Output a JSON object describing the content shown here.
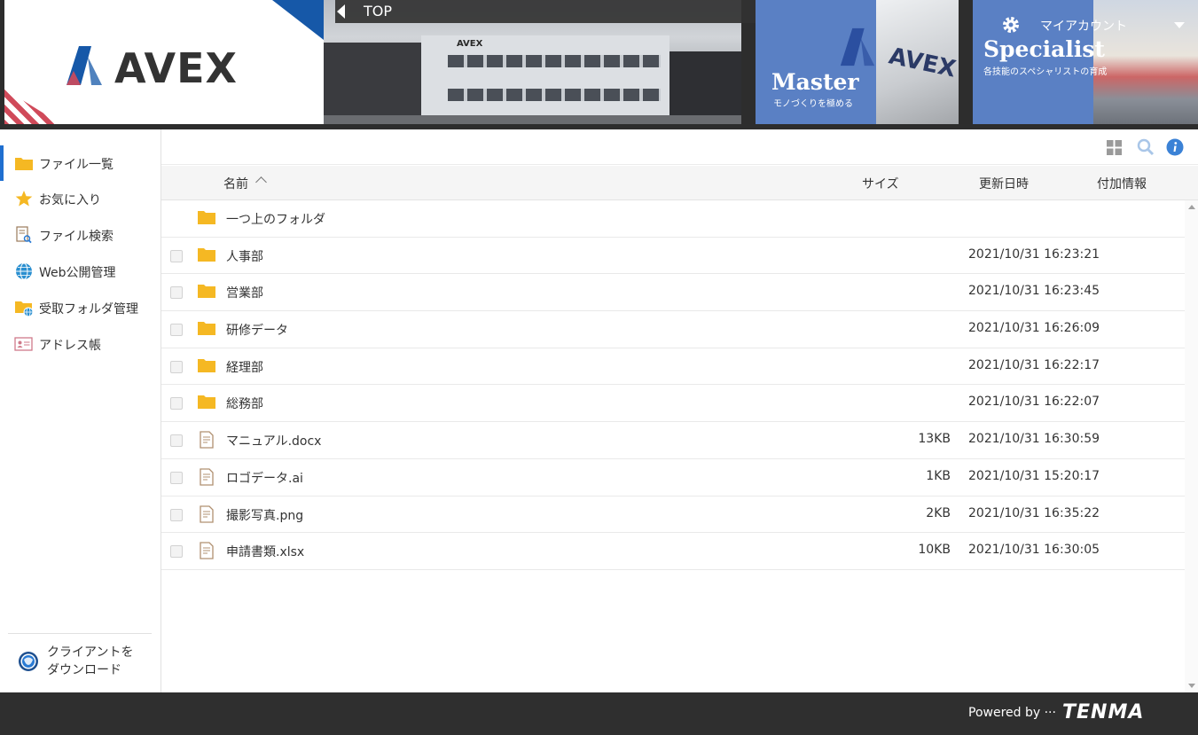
{
  "header": {
    "logo_text": "AVEX",
    "nav_title": "TOP",
    "building_sign": "AVEX",
    "tiles": {
      "master": {
        "title": "Master",
        "subtitle": "モノづくりを極める",
        "logo": "AVEX"
      },
      "specialist": {
        "title": "Specialist",
        "subtitle": "各技能のスペシャリストの育成"
      }
    },
    "account_label": "マイアカウント",
    "brand_colors": {
      "blue": "#1658a8",
      "tile_blue": "#5a80c4",
      "stripe_red": "#d04a5a"
    }
  },
  "sidebar": {
    "items": [
      {
        "label": "ファイル一覧",
        "icon": "folder-icon",
        "active": true
      },
      {
        "label": "お気に入り",
        "icon": "star-icon",
        "active": false
      },
      {
        "label": "ファイル検索",
        "icon": "file-search-icon",
        "active": false
      },
      {
        "label": "Web公開管理",
        "icon": "globe-icon",
        "active": false
      },
      {
        "label": "受取フォルダ管理",
        "icon": "folder-globe-icon",
        "active": false
      },
      {
        "label": "アドレス帳",
        "icon": "address-card-icon",
        "active": false
      }
    ],
    "client_download_line1": "クライアントを",
    "client_download_line2": "ダウンロード"
  },
  "table": {
    "columns": {
      "name": "名前",
      "size": "サイズ",
      "modified": "更新日時",
      "extra": "付加情報"
    },
    "parent_folder": "一つ上のフォルダ",
    "rows": [
      {
        "type": "folder",
        "name": "人事部",
        "size": "",
        "modified": "2021/10/31 16:23:21"
      },
      {
        "type": "folder",
        "name": "営業部",
        "size": "",
        "modified": "2021/10/31 16:23:45"
      },
      {
        "type": "folder",
        "name": "研修データ",
        "size": "",
        "modified": "2021/10/31 16:26:09"
      },
      {
        "type": "folder",
        "name": "経理部",
        "size": "",
        "modified": "2021/10/31 16:22:17"
      },
      {
        "type": "folder",
        "name": "総務部",
        "size": "",
        "modified": "2021/10/31 16:22:07"
      },
      {
        "type": "file",
        "name": "マニュアル.docx",
        "size": "13KB",
        "modified": "2021/10/31 16:30:59"
      },
      {
        "type": "file",
        "name": "ロゴデータ.ai",
        "size": "1KB",
        "modified": "2021/10/31 15:20:17"
      },
      {
        "type": "file",
        "name": "撮影写真.png",
        "size": "2KB",
        "modified": "2021/10/31 16:35:22"
      },
      {
        "type": "file",
        "name": "申請書類.xlsx",
        "size": "10KB",
        "modified": "2021/10/31 16:30:05"
      }
    ]
  },
  "footer": {
    "powered_by": "Powered by ···",
    "brand": "TENMA"
  }
}
